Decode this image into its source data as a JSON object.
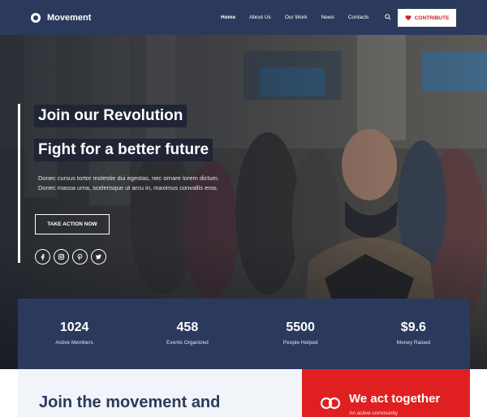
{
  "nav": {
    "brand": "Movement",
    "links": [
      "Home",
      "About Us",
      "Our Work",
      "News",
      "Contacts"
    ],
    "active_link": "Home",
    "contribute_label": "CONTRIBUTE"
  },
  "hero": {
    "headline_1": "Join our Revolution",
    "headline_2": "Fight for a better future",
    "blurb": "Donec cursus tortor molestie dui egestas, nec ornare lorem dictum. Donec massa urna, scelerisque ut arcu in, maximus convallis eros.",
    "cta_label": "TAKE ACTION NOW",
    "socials": [
      "facebook-icon",
      "instagram-icon",
      "pinterest-icon",
      "twitter-icon"
    ]
  },
  "stats": [
    {
      "value": "1024",
      "label": "Active Members"
    },
    {
      "value": "458",
      "label": "Events Organized"
    },
    {
      "value": "5500",
      "label": "People Helped"
    },
    {
      "value": "$9.6",
      "label": "Money Raised"
    }
  ],
  "join": {
    "title": "Join the movement and"
  },
  "together": {
    "title": "We act together",
    "subtitle": "An active community"
  },
  "colors": {
    "navy": "#2b3a5c",
    "accent_red": "#e02020",
    "light_panel": "#f1f4f8"
  }
}
